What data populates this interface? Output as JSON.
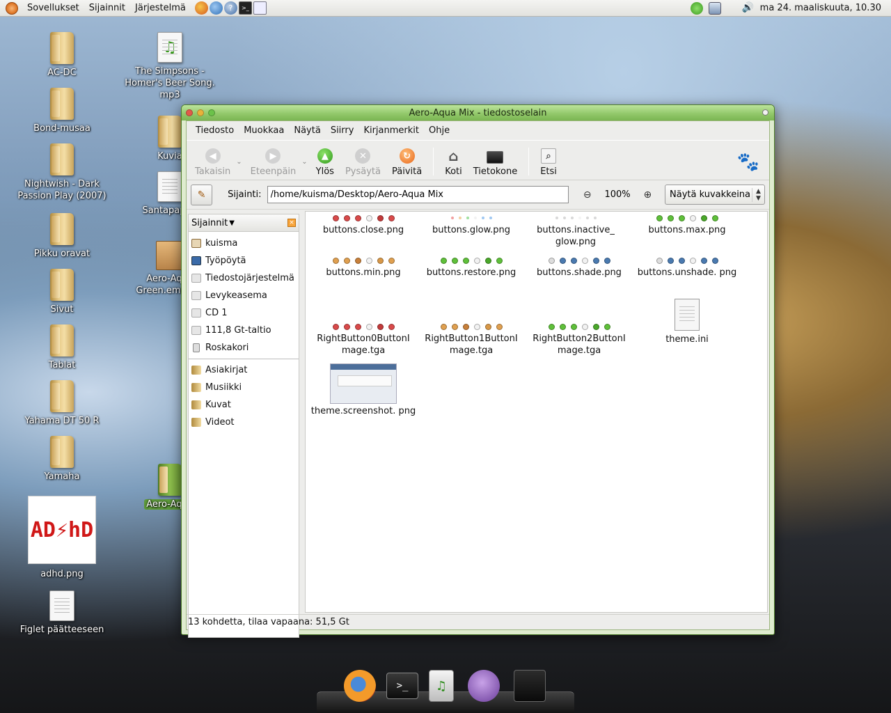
{
  "top_panel": {
    "menus": [
      "Sovellukset",
      "Sijainnit",
      "Järjestelmä"
    ],
    "clock": "ma 24. maaliskuuta, 10.30"
  },
  "desktop": {
    "icons": [
      {
        "label": "AC-DC"
      },
      {
        "label": "Bond-musaa"
      },
      {
        "label": "Nightwish - Dark Passion Play (2007)"
      },
      {
        "label": "Pikku oravat"
      },
      {
        "label": "Sivut"
      },
      {
        "label": "Tablat"
      },
      {
        "label": "Yahama DT 50 R"
      },
      {
        "label": "Yamaha"
      },
      {
        "label": "adhd.png",
        "thumb_text": "AD⚡hD"
      },
      {
        "label": "Figlet päätteeseen"
      },
      {
        "label": "The Simpsons - Homer's Beer Song. mp3"
      },
      {
        "label": "Kuvia"
      },
      {
        "label": "Santapaperi"
      },
      {
        "label": "Aero-Aqua Green.emerald"
      },
      {
        "label": "Aero-Aqua"
      }
    ]
  },
  "window": {
    "title": "Aero-Aqua Mix - tiedostoselain",
    "menubar": [
      "Tiedosto",
      "Muokkaa",
      "Näytä",
      "Siirry",
      "Kirjanmerkit",
      "Ohje"
    ],
    "toolbar": {
      "back": "Takaisin",
      "forward": "Eteenpäin",
      "up": "Ylös",
      "stop": "Pysäytä",
      "reload": "Päivitä",
      "home": "Koti",
      "computer": "Tietokone",
      "search": "Etsi"
    },
    "location": {
      "label": "Sijainti:",
      "path": "/home/kuisma/Desktop/Aero-Aqua Mix",
      "zoom": "100%",
      "view_mode": "Näytä kuvakkeina"
    },
    "sidebar": {
      "header": "Sijainnit",
      "places": [
        "kuisma",
        "Työpöytä",
        "Tiedostojärjestelmä",
        "Levykeasema",
        "CD 1",
        "111,8 Gt-taltio",
        "Roskakori"
      ],
      "bookmarks": [
        "Asiakirjat",
        "Musiikki",
        "Kuvat",
        "Videot"
      ]
    },
    "files": [
      {
        "name": "buttons.close.png",
        "dots": "red"
      },
      {
        "name": "buttons.glow.png",
        "dots": "glow"
      },
      {
        "name": "buttons.inactive_ glow.png",
        "dots": "inactive"
      },
      {
        "name": "buttons.max.png",
        "dots": "green"
      },
      {
        "name": "buttons.min.png",
        "dots": "orange"
      },
      {
        "name": "buttons.restore.png",
        "dots": "green"
      },
      {
        "name": "buttons.shade.png",
        "dots": "blue"
      },
      {
        "name": "buttons.unshade. png",
        "dots": "blue"
      },
      {
        "name": "RightButton0ButtonI mage.tga",
        "dots": "red"
      },
      {
        "name": "RightButton1ButtonI mage.tga",
        "dots": "orange"
      },
      {
        "name": "RightButton2ButtonI mage.tga",
        "dots": "green"
      },
      {
        "name": "theme.ini",
        "dots": "none"
      },
      {
        "name": "theme.screenshot. png",
        "dots": "none"
      }
    ],
    "status": "13 kohdetta, tilaa vapaana: 51,5 Gt"
  },
  "colors": {
    "window_frame": "#7ab552",
    "selection": "#5d9a3a"
  }
}
